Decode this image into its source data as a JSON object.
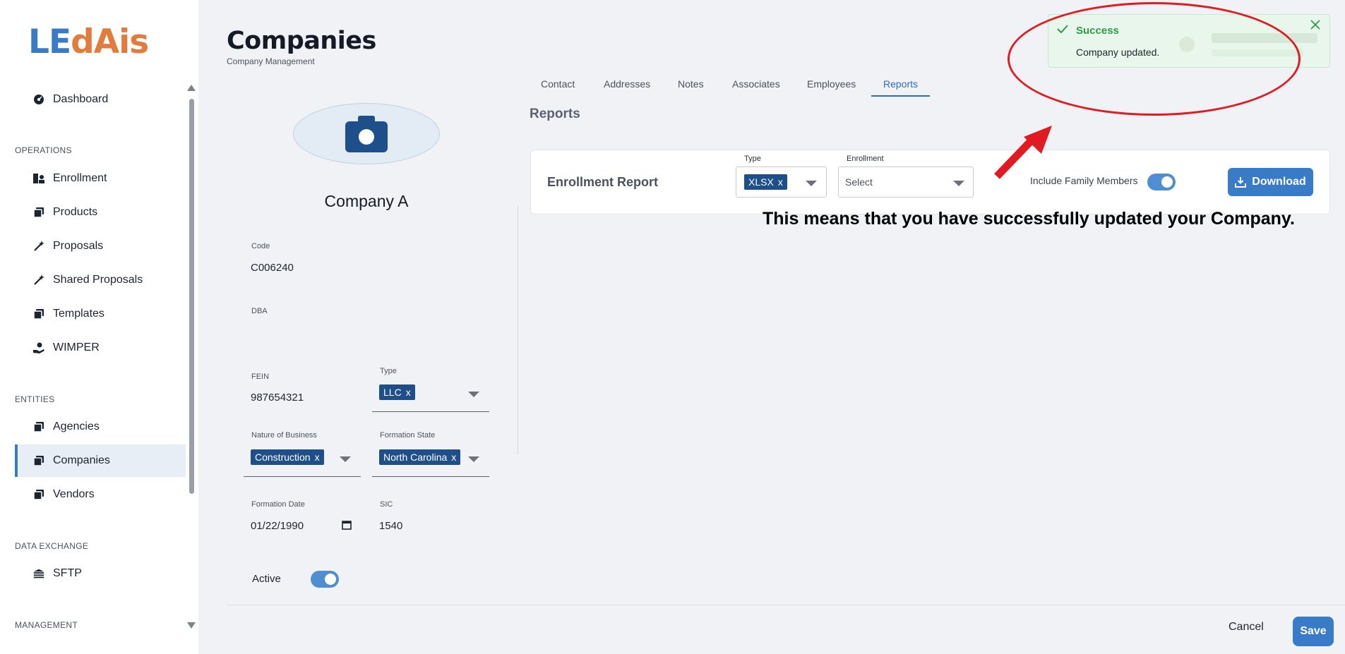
{
  "logo": {
    "part1": "LE",
    "part2": "dAis"
  },
  "sidebar": {
    "dashboard": "Dashboard",
    "sections": {
      "operations": "OPERATIONS",
      "entities": "ENTITIES",
      "data_exchange": "DATA EXCHANGE",
      "management": "MANAGEMENT"
    },
    "operations_items": [
      "Enrollment",
      "Products",
      "Proposals",
      "Shared Proposals",
      "Templates",
      "WIMPER"
    ],
    "entities_items": [
      "Agencies",
      "Companies",
      "Vendors"
    ],
    "data_exchange_items": [
      "SFTP"
    ],
    "active_item": "Companies"
  },
  "header": {
    "title": "Companies",
    "subtitle": "Company Management"
  },
  "company": {
    "name": "Company A",
    "code_label": "Code",
    "code": "C006240",
    "dba_label": "DBA",
    "dba": "",
    "fein_label": "FEIN",
    "fein": "987654321",
    "type_label": "Type",
    "type": "LLC",
    "nature_label": "Nature of Business",
    "nature": "Construction",
    "formation_state_label": "Formation State",
    "formation_state": "North Carolina",
    "formation_date_label": "Formation Date",
    "formation_date": "01/22/1990",
    "sic_label": "SIC",
    "sic": "1540",
    "active_label": "Active",
    "active": true,
    "chip_remove": "x"
  },
  "tabs": [
    "Contact",
    "Addresses",
    "Notes",
    "Associates",
    "Employees",
    "Reports"
  ],
  "active_tab": "Reports",
  "reports": {
    "heading": "Reports",
    "enrollment_report": {
      "title": "Enrollment Report",
      "type_label": "Type",
      "type_value": "XLSX",
      "enrollment_label": "Enrollment",
      "enrollment_placeholder": "Select",
      "include_family_label": "Include Family Members",
      "include_family": true,
      "download_label": "Download"
    }
  },
  "toast": {
    "title": "Success",
    "message": "Company updated."
  },
  "annotation": "This means that you have successfully updated your Company.",
  "footer": {
    "cancel": "Cancel",
    "save": "Save"
  },
  "colors": {
    "primary": "#3a7bc8",
    "brand_orange": "#e27c3e",
    "chip": "#1f4f8a",
    "success": "#2f9a48",
    "annotation_red": "#e11b22"
  }
}
